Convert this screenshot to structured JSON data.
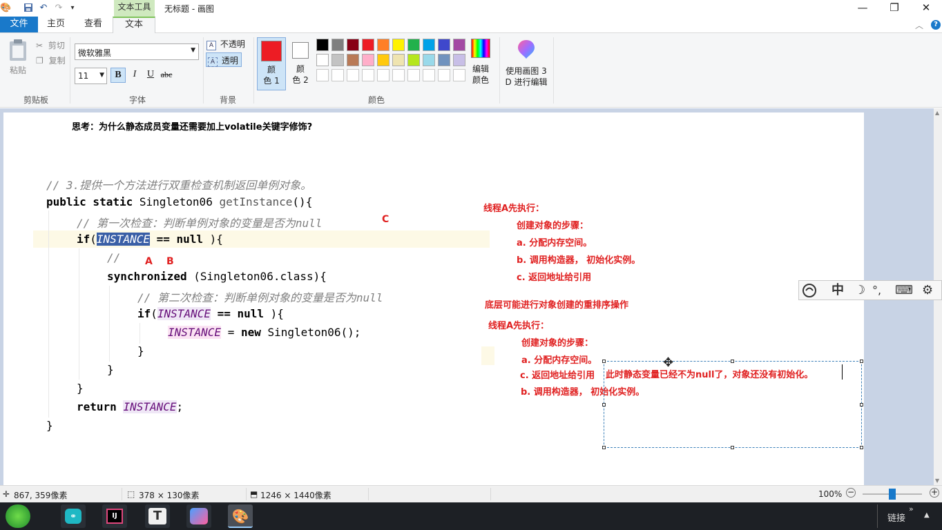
{
  "window": {
    "context_tab": "文本工具",
    "title": "无标题 - 画图",
    "minimize": "—",
    "restore": "❐",
    "close": "✕"
  },
  "tabs": {
    "file": "文件",
    "home": "主页",
    "view": "查看",
    "text": "文本",
    "collapse": "︿",
    "help": "?"
  },
  "clipboard": {
    "paste": "粘贴",
    "cut": "剪切",
    "copy": "复制",
    "group": "剪贴板"
  },
  "font": {
    "family": "微软雅黑",
    "size": "11",
    "bold": "B",
    "italic": "I",
    "underline": "U",
    "strike": "abc",
    "group": "字体"
  },
  "background": {
    "opaque": "不透明",
    "transparent": "透明",
    "group": "背景"
  },
  "colors": {
    "color1_line1": "颜",
    "color1_line2": "色 1",
    "color2_line1": "颜",
    "color2_line2": "色 2",
    "edit_line1": "编辑",
    "edit_line2": "颜色",
    "group": "颜色",
    "color1_value": "#ed1c24",
    "color2_value": "#ffffff",
    "palette_row1": [
      "#000000",
      "#7f7f7f",
      "#880015",
      "#ed1c24",
      "#ff7f27",
      "#fff200",
      "#22b14c",
      "#00a2e8",
      "#3f48cc",
      "#a349a4"
    ],
    "palette_row2": [
      "#ffffff",
      "#c3c3c3",
      "#b97a57",
      "#ffaec9",
      "#ffc90e",
      "#efe4b0",
      "#b5e61d",
      "#99d9ea",
      "#7092be",
      "#c8bfe7"
    ]
  },
  "paint3d": {
    "line1": "使用画图 3",
    "line2": "D 进行编辑"
  },
  "canvas": {
    "header": "思考：为什么静态成员变量还需要加上volatile关键字修饰?",
    "code": {
      "comment3": "// 3.提供一个方法进行双重检查机制返回单例对象。",
      "sig_kw": "public static ",
      "sig_type": "Singleton06 ",
      "sig_method": "getInstance",
      "sig_tail": "(){",
      "comment_first": "// 第一次检查：判断单例对象的变量是否为null",
      "if_kw": "if",
      "instance": "INSTANCE",
      "eq_null": " == null ",
      "if1_tail": "){",
      "slash": "//",
      "sync_kw": "synchronized",
      "sync_tail": " (Singleton06.class){",
      "comment_second": "// 第二次检查：判断单例对象的变量是否为null",
      "if2_tail": "){",
      "assign_eq": " = ",
      "new_kw": "new",
      "new_tail": " Singleton06();",
      "close": "}",
      "return_kw": "return ",
      "semicolon": ";"
    },
    "label_c": "C",
    "label_a": "A",
    "label_b": "B",
    "notes1": {
      "title": "线程A先执行：",
      "steps_title": "创建对象的步骤：",
      "step_a": "a. 分配内存空间。",
      "step_b": "b. 调用构造器，  初始化实例。",
      "step_c": "c. 返回地址给引用"
    },
    "reorder": "底层可能进行对象创建的重排序操作",
    "notes2": {
      "title": "线程A先执行：",
      "steps_title": "创建对象的步骤：",
      "step_a": "a. 分配内存空间。",
      "step_c": "c. 返回地址给引用",
      "step_b": "b. 调用构造器，  初始化实例。"
    },
    "textbox": "此时静态变量已经不为null了，对象还没有初始化。"
  },
  "ime": {
    "mode": "中",
    "moon": "☽",
    "punct": "°,",
    "keyboard": "⌨",
    "settings": "⚙"
  },
  "status": {
    "cursor": "867, 359像素",
    "selection": "378 × 130像素",
    "image_size": "1246 × 1440像素",
    "zoom": "100%"
  },
  "taskbar": {
    "links": "链接",
    "chevron": "»"
  }
}
